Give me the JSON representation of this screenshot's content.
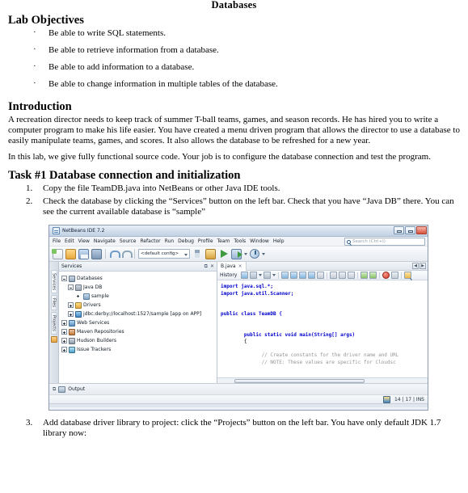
{
  "document": {
    "title": "Databases",
    "sections": {
      "objectives_heading": "Lab Objectives",
      "objectives": [
        "Be able to write SQL statements.",
        "Be able to retrieve information from a database.",
        "Be able to add information to a database.",
        "Be able to change information in multiple tables of the database."
      ],
      "intro_heading": "Introduction",
      "intro_p1": "A recreation director needs to keep track of summer T-ball teams, games, and season records. He has hired you to write a computer program to make his life easier. You have created a menu driven program that allows the director to use a database to easily manipulate teams, games, and scores. It also allows the database to be refreshed for a new year.",
      "intro_p2": "In this lab, we give fully functional source code. Your job is to configure the database connection and test the program.",
      "task_heading": "Task #1 Database connection and initialization",
      "steps": [
        {
          "num": "1.",
          "text": "Copy the file TeamDB.java into NetBeans or other Java IDE tools."
        },
        {
          "num": "2.",
          "text": "Check the database by clicking the “Services” button on the left bar. Check that you have “Java DB” there. You can see the current available database is “sample”"
        },
        {
          "num": "3.",
          "text": "Add database driver library to project: click the “Projects” button on the left bar. You have only default JDK 1.7 library now:"
        }
      ]
    },
    "bullet_glyph": "·"
  },
  "netbeans": {
    "window_title": "NetBeans IDE 7.2",
    "window_controls": [
      "minimize",
      "maximize",
      "close"
    ],
    "menus": [
      "File",
      "Edit",
      "View",
      "Navigate",
      "Source",
      "Refactor",
      "Run",
      "Debug",
      "Profile",
      "Team",
      "Tools",
      "Window",
      "Help"
    ],
    "search_placeholder": "Search (Ctrl+I)",
    "toolbar": {
      "config_value": "<default config>",
      "buttons": [
        "new-file",
        "open-project",
        "save-all",
        "stack",
        "undo",
        "redo",
        "build",
        "clean-and-build",
        "run",
        "debug",
        "profile"
      ]
    },
    "left_vertical_tabs": [
      "Services",
      "Files",
      "Projects"
    ],
    "services_pane": {
      "title": "Services",
      "tree": [
        {
          "label": "Databases",
          "indent": 0,
          "icon": "database-icon",
          "expander": "open"
        },
        {
          "label": "Java DB",
          "indent": 1,
          "icon": "java-db-icon",
          "expander": "open"
        },
        {
          "label": "sample",
          "indent": 2,
          "icon": "sample-db-icon",
          "expander": "none"
        },
        {
          "label": "Drivers",
          "indent": 1,
          "icon": "drivers-icon",
          "expander": "closed"
        },
        {
          "label": "jdbc:derby://localhost:1527/sample [app on APP]",
          "indent": 1,
          "icon": "connection-icon",
          "expander": "closed"
        },
        {
          "label": "Web Services",
          "indent": 0,
          "icon": "web-services-icon",
          "expander": "closed"
        },
        {
          "label": "Maven Repositories",
          "indent": 0,
          "icon": "maven-icon",
          "expander": "closed"
        },
        {
          "label": "Hudson Builders",
          "indent": 0,
          "icon": "hudson-icon",
          "expander": "closed"
        },
        {
          "label": "Issue Trackers",
          "indent": 0,
          "icon": "issue-tracker-icon",
          "expander": "closed"
        }
      ]
    },
    "editor": {
      "tab_label": "B.java",
      "tab_close": "×",
      "history_label": "History",
      "code_lines": [
        {
          "text": "import java.sql.*;",
          "style": "kw-line"
        },
        {
          "text": "import java.util.Scanner;",
          "style": "kw-line"
        },
        {
          "text": "",
          "style": "plain"
        },
        {
          "text": "",
          "style": "plain"
        },
        {
          "text": "public class TeamDB {",
          "style": "kw-line"
        },
        {
          "text": "",
          "style": "plain"
        },
        {
          "text": "",
          "style": "plain"
        },
        {
          "text": "        public static void main(String[] args)",
          "style": "kw-line"
        },
        {
          "text": "        {",
          "style": "plain"
        },
        {
          "text": "",
          "style": "plain"
        },
        {
          "text": "              // Create constants for the driver name and URL",
          "style": "comment"
        },
        {
          "text": "              // NOTE: These values are specific for Cloudsc",
          "style": "comment"
        }
      ]
    },
    "output_pane": {
      "label": "Output"
    },
    "status_bar": {
      "position": "14 | 17 | INS"
    }
  }
}
